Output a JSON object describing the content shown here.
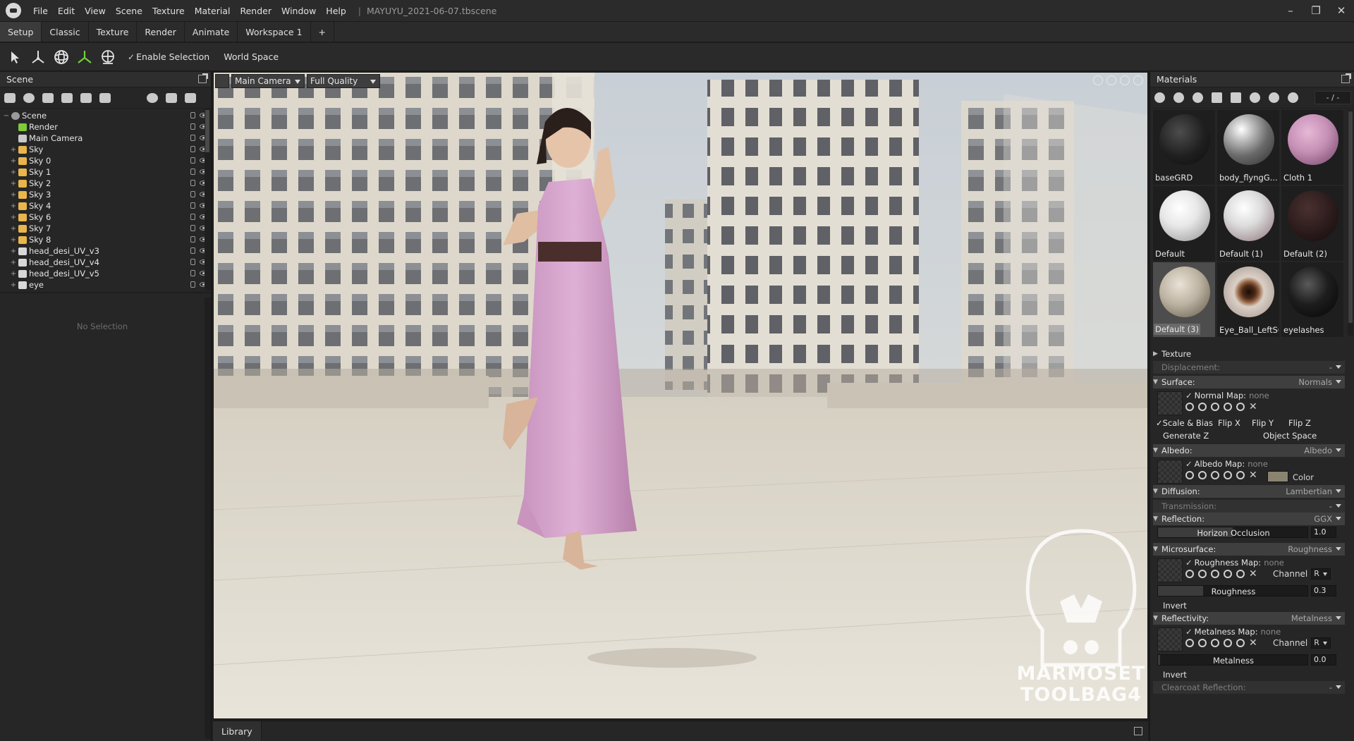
{
  "titlebar": {
    "menus": [
      "File",
      "Edit",
      "View",
      "Scene",
      "Texture",
      "Material",
      "Render",
      "Window",
      "Help"
    ],
    "document": "MAYUYU_2021-06-07.tbscene",
    "separator": "|"
  },
  "workspace_tabs": [
    "Setup",
    "Classic",
    "Texture",
    "Render",
    "Animate",
    "Workspace 1",
    "+"
  ],
  "toolbar": {
    "tools": [
      "select-icon",
      "move-icon",
      "rotate-icon",
      "gizmo-icon",
      "scale-icon"
    ],
    "enable_selection": "Enable Selection",
    "world_space": "World Space",
    "enable_selection_checked": true,
    "world_space_checked": false
  },
  "scene": {
    "title": "Scene",
    "toolbar_icons": [
      "add-mesh-icon",
      "add-light-icon",
      "add-camera-icon",
      "add-sky-icon",
      "add-shadow-catcher-icon",
      "add-turntable-icon",
      "new-folder-icon",
      "duplicate-icon",
      "delete-icon"
    ],
    "tree": [
      {
        "label": "Scene",
        "depth": 0,
        "icon": "scene",
        "color": "#9a9a9a"
      },
      {
        "label": "Render",
        "depth": 1,
        "icon": "render",
        "color": "#7ecb3d"
      },
      {
        "label": "Main Camera",
        "depth": 1,
        "icon": "camera",
        "color": "#c9c9c9"
      },
      {
        "label": "Sky",
        "depth": 1,
        "icon": "sky",
        "color": "#e8b64a"
      },
      {
        "label": "Sky 0",
        "depth": 1,
        "icon": "sky",
        "color": "#e8b64a"
      },
      {
        "label": "Sky 1",
        "depth": 1,
        "icon": "sky",
        "color": "#e8b64a"
      },
      {
        "label": "Sky 2",
        "depth": 1,
        "icon": "sky",
        "color": "#e8b64a"
      },
      {
        "label": "Sky 3",
        "depth": 1,
        "icon": "sky",
        "color": "#e8b64a"
      },
      {
        "label": "Sky 4",
        "depth": 1,
        "icon": "sky",
        "color": "#e8b64a"
      },
      {
        "label": "Sky 6",
        "depth": 1,
        "icon": "sky",
        "color": "#e8b64a"
      },
      {
        "label": "Sky 7",
        "depth": 1,
        "icon": "sky",
        "color": "#e8b64a"
      },
      {
        "label": "Sky 8",
        "depth": 1,
        "icon": "sky",
        "color": "#e8b64a"
      },
      {
        "label": "head_desi_UV_v3",
        "depth": 1,
        "icon": "mesh",
        "color": "#d8d8d8"
      },
      {
        "label": "head_desi_UV_v4",
        "depth": 1,
        "icon": "mesh",
        "color": "#d8d8d8"
      },
      {
        "label": "head_desi_UV_v5",
        "depth": 1,
        "icon": "mesh",
        "color": "#d8d8d8"
      },
      {
        "label": "eye",
        "depth": 1,
        "icon": "mesh",
        "color": "#d8d8d8"
      }
    ]
  },
  "properties": {
    "empty_text": "No Selection"
  },
  "viewport": {
    "camera": "Main Camera",
    "quality": "Full Quality",
    "watermark_line1": "MARMOSET",
    "watermark_line2": "TOOLBAG4"
  },
  "library": {
    "tab": "Library"
  },
  "materials": {
    "title": "Materials",
    "counter": "- / -",
    "toolbar_icons": [
      "add-material-icon",
      "duplicate-material-icon",
      "template-icon",
      "folder-icon",
      "delete-material-icon",
      "pick-material-icon",
      "apply-material-icon",
      "refresh-icon"
    ],
    "items": [
      {
        "name": "baseGRD",
        "ball": "radial-gradient(circle at 40% 35%, #4d4d4d 0%, #1f1f1f 55%, #0d0d0d 100%)",
        "selected": false
      },
      {
        "name": "body_flyngG...",
        "ball": "radial-gradient(circle at 35% 30%, #ffffff 0%, #b9b9b9 25%, #6a6a6a 55%, #2b2b2b 100%)",
        "selected": false
      },
      {
        "name": "Cloth 1",
        "ball": "radial-gradient(circle at 40% 35%, #e6b8d6 0%, #c690b6 45%, #6d4060 100%)",
        "selected": false
      },
      {
        "name": "Default",
        "ball": "radial-gradient(circle at 40% 35%, #ffffff 0%, #e8e8e8 40%, #8f8f8f 100%)",
        "selected": false
      },
      {
        "name": "Default (1)",
        "ball": "radial-gradient(circle at 40% 35%, #ffffff 0%, #dcdcdc 40%, #8a6f76 100%)",
        "selected": false
      },
      {
        "name": "Default (2)",
        "ball": "radial-gradient(circle at 40% 35%, #4a3030 0%, #2b1b1b 55%, #140b0b 100%)",
        "selected": false
      },
      {
        "name": "Default (3)",
        "ball": "radial-gradient(circle at 40% 35%, #e9e2d6 0%, #bdb3a2 45%, #5d5546 100%)",
        "selected": true
      },
      {
        "name": "Eye_Ball_LeftSG",
        "ball": "radial-gradient(circle at 50% 50%, #1a0d06 0%, #4b2a18 18%, #8d5d3c 28%, #dcd0c6 42%, #9a908a 100%)",
        "selected": false
      },
      {
        "name": "eyelashes",
        "ball": "radial-gradient(circle at 40% 35%, #5a5a5a 0%, #1d1d1d 45%, #050505 100%)",
        "selected": false
      }
    ],
    "texture_section": "Texture",
    "displacement": {
      "label": "Displacement:",
      "value": "-"
    },
    "surface": {
      "label": "Surface:",
      "value": "Normals"
    },
    "normal_map": {
      "label": "Normal Map:",
      "value": "none"
    },
    "scale_bias": "Scale & Bias",
    "flip_x": "Flip X",
    "flip_y": "Flip Y",
    "flip_z": "Flip Z",
    "generate_z": "Generate Z",
    "object_space": "Object Space",
    "albedo": {
      "label": "Albedo:",
      "value": "Albedo"
    },
    "albedo_map": {
      "label": "Albedo Map:",
      "value": "none"
    },
    "color_label": "Color",
    "albedo_color": "#8a8370",
    "diffusion": {
      "label": "Diffusion:",
      "value": "Lambertian"
    },
    "transmission": {
      "label": "Transmission:",
      "value": "-"
    },
    "reflection": {
      "label": "Reflection:",
      "value": "GGX"
    },
    "horizon_occlusion": {
      "label": "Horizon Occlusion",
      "value": "1.0",
      "fraction": 0.5
    },
    "microsurface": {
      "label": "Microsurface:",
      "value": "Roughness"
    },
    "roughness_map": {
      "label": "Roughness Map:",
      "value": "none"
    },
    "channel_label": "Channel",
    "roughness_channel": "R",
    "roughness": {
      "label": "Roughness",
      "value": "0.3",
      "fraction": 0.3
    },
    "invert": "Invert",
    "reflectivity": {
      "label": "Reflectivity:",
      "value": "Metalness"
    },
    "metalness_map": {
      "label": "Metalness Map:",
      "value": "none"
    },
    "metalness_channel": "R",
    "metalness": {
      "label": "Metalness",
      "value": "0.0",
      "fraction": 0.0
    },
    "invert2": "Invert",
    "clearcoat": {
      "label": "Clearcoat Reflection:",
      "value": "-"
    }
  }
}
